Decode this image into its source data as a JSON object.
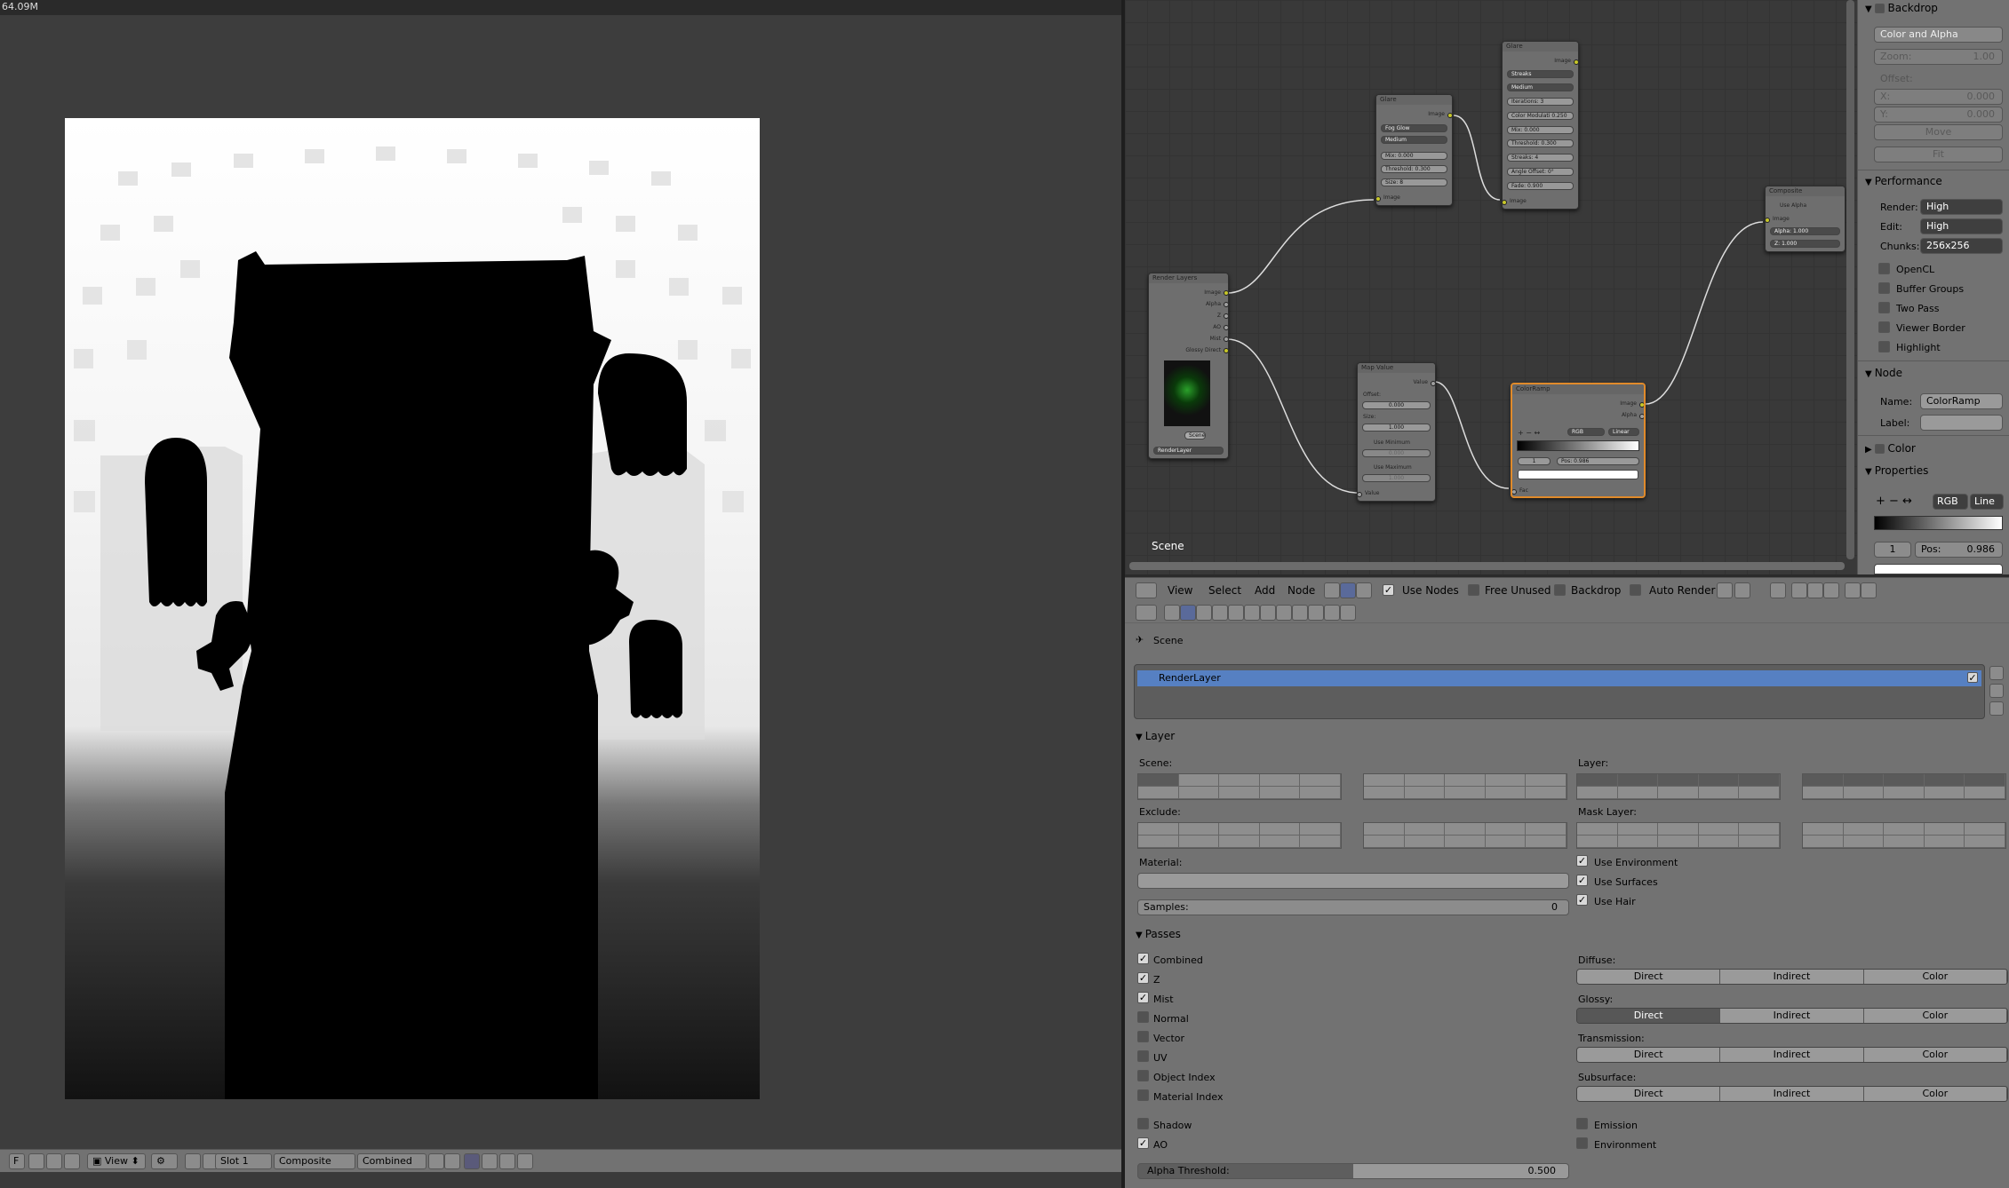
{
  "memory_readout": "64.09M",
  "image_editor": {
    "header": {
      "mode_label": "F",
      "view_menu": "View",
      "slot": "Slot 1",
      "image_name": "Composite",
      "pass": "Combined"
    }
  },
  "node_editor": {
    "scene_label": "Scene",
    "nodes": {
      "render_layers": {
        "title": "Render Layers",
        "outputs": [
          "Image",
          "Alpha",
          "Z",
          "AO",
          "Mist",
          "Glossy Direct"
        ],
        "scene_field": "Scene",
        "layer_field": "RenderLayer"
      },
      "glare1": {
        "title": "Glare",
        "output": "Image",
        "type": "Fog Glow",
        "quality": "Medium",
        "mix": "Mix:",
        "mix_val": "0.000",
        "threshold": "Threshold:",
        "threshold_val": "0.300",
        "size": "Size:",
        "size_val": "8",
        "input": "Image"
      },
      "glare2": {
        "title": "Glare",
        "output": "Image",
        "type": "Streaks",
        "quality": "Medium",
        "iterations": "Iterations:",
        "iterations_val": "3",
        "color_mod": "Color Modulati",
        "color_mod_val": "0.250",
        "mix": "Mix:",
        "mix_val": "0.000",
        "threshold": "Threshold:",
        "threshold_val": "0.300",
        "streaks": "Streaks:",
        "streaks_val": "4",
        "angle": "Angle Offset:",
        "angle_val": "0°",
        "fade": "Fade:",
        "fade_val": "0.900",
        "input": "Image"
      },
      "map_value": {
        "title": "Map Value",
        "output": "Value",
        "offset": "Offset:",
        "offset_val": "0.000",
        "size": "Size:",
        "size_val": "1.000",
        "use_min": "Use Minimum",
        "min_val": "0.000",
        "use_max": "Use Maximum",
        "max_val": "1.000",
        "input": "Value"
      },
      "color_ramp": {
        "title": "ColorRamp",
        "out1": "Image",
        "out2": "Alpha",
        "mode": "RGB",
        "interp": "Linear",
        "index": "1",
        "pos": "Pos:",
        "pos_val": "0.986",
        "input": "Fac"
      },
      "composite": {
        "title": "Composite",
        "use_alpha": "Use Alpha",
        "in_image": "Image",
        "alpha": "Alpha:",
        "alpha_val": "1.000",
        "z": "Z:",
        "z_val": "1.000"
      }
    },
    "header": {
      "view": "View",
      "select": "Select",
      "add": "Add",
      "node": "Node",
      "use_nodes": "Use Nodes",
      "free_unused": "Free Unused",
      "backdrop": "Backdrop",
      "auto_render": "Auto Render"
    },
    "sidebar": {
      "backdrop": "Backdrop",
      "color_alpha": "Color and Alpha",
      "zoom": "Zoom:",
      "zoom_val": "1.00",
      "offset": "Offset:",
      "x": "X:",
      "x_val": "0.000",
      "y": "Y:",
      "y_val": "0.000",
      "move": "Move",
      "fit": "Fit",
      "performance": "Performance",
      "render": "Render:",
      "render_val": "High",
      "edit": "Edit:",
      "edit_val": "High",
      "chunks": "Chunks:",
      "chunks_val": "256x256",
      "opencl": "OpenCL",
      "buffer_groups": "Buffer Groups",
      "two_pass": "Two Pass",
      "viewer_border": "Viewer Border",
      "highlight": "Highlight",
      "node": "Node",
      "name": "Name:",
      "name_val": "ColorRamp",
      "label": "Label:",
      "color": "Color",
      "properties": "Properties",
      "ramp_mode": "RGB",
      "ramp_interp": "Line",
      "ramp_index": "1",
      "ramp_pos": "Pos:",
      "ramp_pos_val": "0.986"
    }
  },
  "properties": {
    "scene": "Scene",
    "render_layer": "RenderLayer",
    "layer_section": "Layer",
    "scene_label": "Scene:",
    "layer_label": "Layer:",
    "exclude": "Exclude:",
    "mask_layer": "Mask Layer:",
    "material": "Material:",
    "use_environment": "Use Environment",
    "use_surfaces": "Use Surfaces",
    "use_hair": "Use Hair",
    "samples": "Samples:",
    "samples_val": "0",
    "passes_section": "Passes",
    "passes": {
      "combined": "Combined",
      "z": "Z",
      "mist": "Mist",
      "normal": "Normal",
      "vector": "Vector",
      "uv": "UV",
      "object_index": "Object Index",
      "material_index": "Material Index",
      "shadow": "Shadow",
      "ao": "AO",
      "emission": "Emission",
      "environment": "Environment"
    },
    "diffuse": "Diffuse:",
    "glossy": "Glossy:",
    "transmission": "Transmission:",
    "subsurface": "Subsurface:",
    "direct": "Direct",
    "indirect": "Indirect",
    "color": "Color",
    "alpha_threshold": "Alpha Threshold:",
    "alpha_threshold_val": "0.500"
  }
}
